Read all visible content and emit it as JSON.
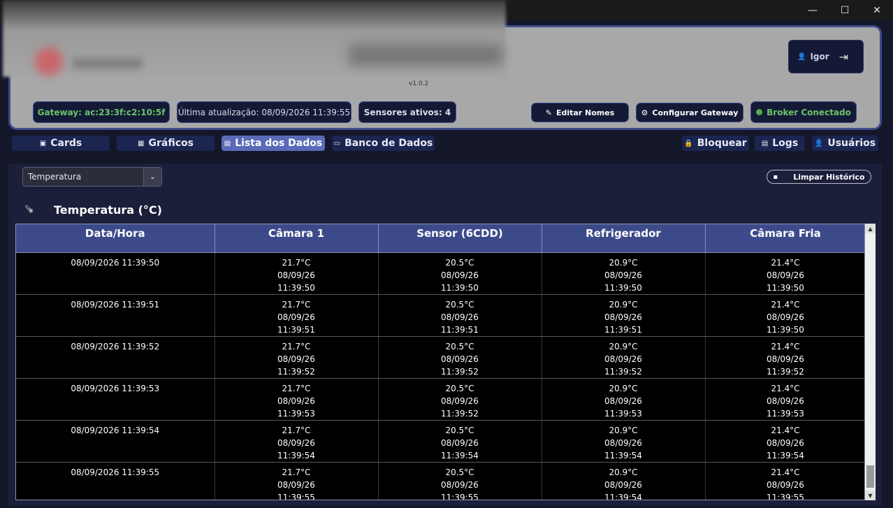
{
  "window": {
    "minimize": "—",
    "maximize": "☐",
    "close": "✕"
  },
  "header": {
    "version": "v1.0.2",
    "user": {
      "name": "Igor",
      "icon": "user-icon",
      "logout_icon": "logout-icon"
    },
    "gateway": "Gateway: ac:23:3f:c2:10:5f",
    "last_update": "Última atualização: 08/09/2026 11:39:55",
    "sensors_active": "Sensores ativos: 4",
    "edit_names": "Editar Nomes",
    "config_gateway": "Configurar Gateway",
    "broker": "Broker Conectado",
    "colors": {
      "panel": "#a8a8a8",
      "accent": "#3d4a8a",
      "ok": "#6ac46a"
    }
  },
  "nav": {
    "cards": "Cards",
    "graficos": "Gráficos",
    "lista": "Lista dos Dados",
    "banco": "Banco de Dados",
    "bloquear": "Bloquear",
    "logs": "Logs",
    "usuarios": "Usuários",
    "active": "Lista dos Dados"
  },
  "content": {
    "selected_type": "Temperatura",
    "clear_history": "Limpar Histórico",
    "section_title": "Temperatura (°C)",
    "table": {
      "headers": [
        "Data/Hora",
        "Câmara 1",
        "Sensor (6CDD)",
        "Refrigerador",
        "Câmara Fria"
      ],
      "rows": [
        [
          "08/09/2026 11:39:50",
          [
            "21.7°C",
            "08/09/26",
            "11:39:50"
          ],
          [
            "20.5°C",
            "08/09/26",
            "11:39:50"
          ],
          [
            "20.9°C",
            "08/09/26",
            "11:39:50"
          ],
          [
            "21.4°C",
            "08/09/26",
            "11:39:50"
          ]
        ],
        [
          "08/09/2026 11:39:51",
          [
            "21.7°C",
            "08/09/26",
            "11:39:51"
          ],
          [
            "20.5°C",
            "08/09/26",
            "11:39:51"
          ],
          [
            "20.9°C",
            "08/09/26",
            "11:39:51"
          ],
          [
            "21.4°C",
            "08/09/26",
            "11:39:50"
          ]
        ],
        [
          "08/09/2026 11:39:52",
          [
            "21.7°C",
            "08/09/26",
            "11:39:52"
          ],
          [
            "20.5°C",
            "08/09/26",
            "11:39:52"
          ],
          [
            "20.9°C",
            "08/09/26",
            "11:39:52"
          ],
          [
            "21.4°C",
            "08/09/26",
            "11:39:52"
          ]
        ],
        [
          "08/09/2026 11:39:53",
          [
            "21.7°C",
            "08/09/26",
            "11:39:53"
          ],
          [
            "20.5°C",
            "08/09/26",
            "11:39:52"
          ],
          [
            "20.9°C",
            "08/09/26",
            "11:39:53"
          ],
          [
            "21.4°C",
            "08/09/26",
            "11:39:53"
          ]
        ],
        [
          "08/09/2026 11:39:54",
          [
            "21.7°C",
            "08/09/26",
            "11:39:54"
          ],
          [
            "20.5°C",
            "08/09/26",
            "11:39:54"
          ],
          [
            "20.9°C",
            "08/09/26",
            "11:39:54"
          ],
          [
            "21.4°C",
            "08/09/26",
            "11:39:54"
          ]
        ],
        [
          "08/09/2026 11:39:55",
          [
            "21.7°C",
            "08/09/26",
            "11:39:55"
          ],
          [
            "20.5°C",
            "08/09/26",
            "11:39:55"
          ],
          [
            "20.9°C",
            "08/09/26",
            "11:39:54"
          ],
          [
            "21.4°C",
            "08/09/26",
            "11:39:55"
          ]
        ]
      ]
    }
  }
}
